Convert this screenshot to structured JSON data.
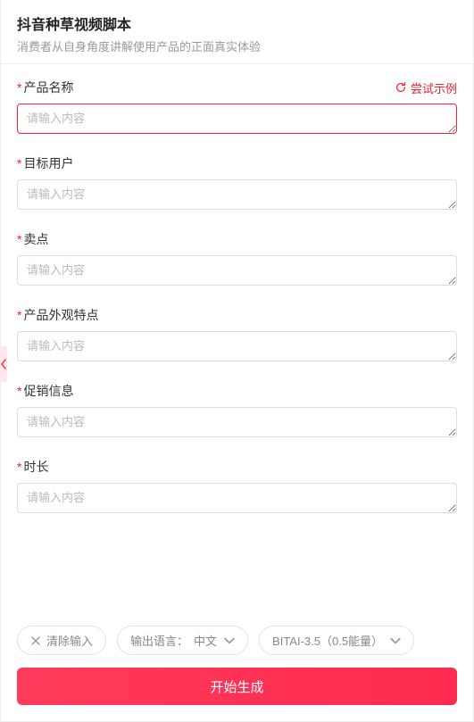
{
  "header": {
    "title": "抖音种草视频脚本",
    "subtitle": "消费者从自身角度讲解使用产品的正面真实体验"
  },
  "tryExample": {
    "label": "尝试示例"
  },
  "placeholder": "请输入内容",
  "fields": [
    {
      "key": "product_name",
      "label": "产品名称",
      "required": true,
      "hasExample": true,
      "error": true
    },
    {
      "key": "target_user",
      "label": "目标用户",
      "required": true
    },
    {
      "key": "selling_point",
      "label": "卖点",
      "required": true
    },
    {
      "key": "appearance",
      "label": "产品外观特点",
      "required": true
    },
    {
      "key": "promotion",
      "label": "促销信息",
      "required": true
    },
    {
      "key": "duration",
      "label": "时长",
      "required": true
    }
  ],
  "footer": {
    "clear": "清除输入",
    "langLabel": "输出语言：",
    "langValue": "中文",
    "model": "BITAI-3.5（0.5能量）",
    "submit": "开始生成"
  }
}
